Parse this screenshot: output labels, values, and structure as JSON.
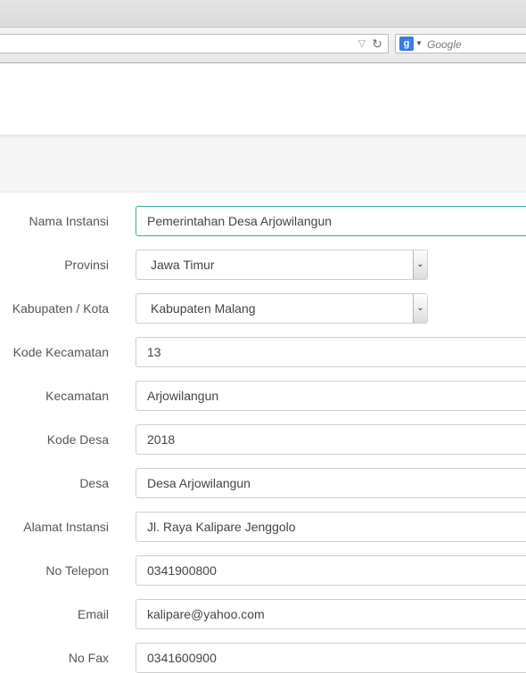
{
  "browser": {
    "search_placeholder": "Google",
    "search_engine_glyph": "g",
    "icons": [
      "url-dropdown-icon",
      "reload-icon",
      "google-search-icon",
      "chevron-down-icon",
      "select-arrow-icon"
    ]
  },
  "colors": {
    "focus_border": "#3aa8a0",
    "label_text": "#555555",
    "field_border": "#cfcfcf"
  },
  "form": {
    "fields": [
      {
        "label": "Nama Instansi",
        "value": "Pemerintahan Desa Arjowilangun",
        "type": "text",
        "focused": true
      },
      {
        "label": "Provinsi",
        "value": "Jawa Timur",
        "type": "select"
      },
      {
        "label": "Kabupaten / Kota",
        "value": "Kabupaten Malang",
        "type": "select"
      },
      {
        "label": "Kode Kecamatan",
        "value": "13",
        "type": "text"
      },
      {
        "label": "Kecamatan",
        "value": "Arjowilangun",
        "type": "text"
      },
      {
        "label": "Kode Desa",
        "value": "2018",
        "type": "text"
      },
      {
        "label": "Desa",
        "value": "Desa Arjowilangun",
        "type": "text"
      },
      {
        "label": "Alamat Instansi",
        "value": "Jl. Raya Kalipare Jenggolo",
        "type": "text"
      },
      {
        "label": "No Telepon",
        "value": "0341900800",
        "type": "text"
      },
      {
        "label": "Email",
        "value": "kalipare@yahoo.com",
        "type": "text"
      },
      {
        "label": "No Fax",
        "value": "0341600900",
        "type": "text"
      }
    ]
  }
}
